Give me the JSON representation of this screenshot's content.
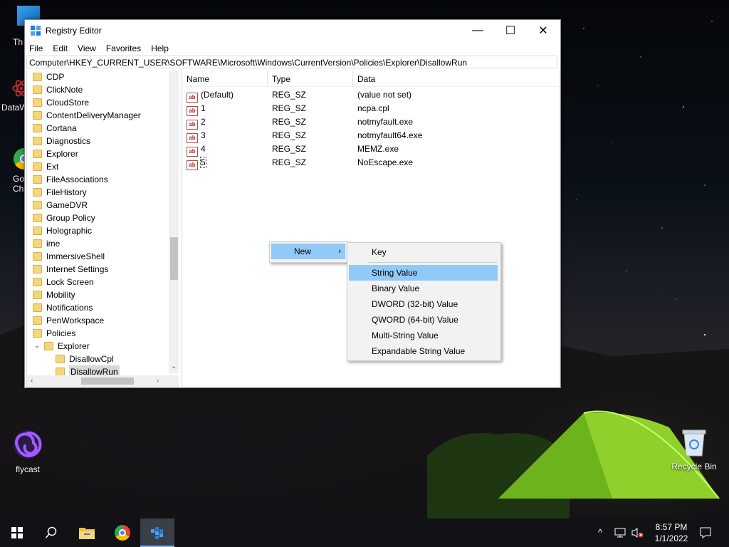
{
  "window": {
    "title": "Registry Editor",
    "controls": {
      "minimize": "—",
      "maximize": "☐",
      "close": "✕"
    },
    "menu": [
      "File",
      "Edit",
      "View",
      "Favorites",
      "Help"
    ],
    "address": "Computer\\HKEY_CURRENT_USER\\SOFTWARE\\Microsoft\\Windows\\CurrentVersion\\Policies\\Explorer\\DisallowRun"
  },
  "tree": {
    "items": [
      {
        "label": "CDP"
      },
      {
        "label": "ClickNote"
      },
      {
        "label": "CloudStore"
      },
      {
        "label": "ContentDeliveryManager"
      },
      {
        "label": "Cortana"
      },
      {
        "label": "Diagnostics"
      },
      {
        "label": "Explorer"
      },
      {
        "label": "Ext"
      },
      {
        "label": "FileAssociations"
      },
      {
        "label": "FileHistory"
      },
      {
        "label": "GameDVR"
      },
      {
        "label": "Group Policy"
      },
      {
        "label": "Holographic"
      },
      {
        "label": "ime"
      },
      {
        "label": "ImmersiveShell"
      },
      {
        "label": "Internet Settings"
      },
      {
        "label": "Lock Screen"
      },
      {
        "label": "Mobility"
      },
      {
        "label": "Notifications"
      },
      {
        "label": "PenWorkspace"
      },
      {
        "label": "Policies"
      },
      {
        "label": "Explorer"
      },
      {
        "label": "DisallowCpl"
      },
      {
        "label": "DisallowRun"
      }
    ]
  },
  "list": {
    "columns": [
      "Name",
      "Type",
      "Data"
    ],
    "rows": [
      {
        "name": "(Default)",
        "type": "REG_SZ",
        "data": "(value not set)"
      },
      {
        "name": "1",
        "type": "REG_SZ",
        "data": "ncpa.cpl"
      },
      {
        "name": "2",
        "type": "REG_SZ",
        "data": "notmyfault.exe"
      },
      {
        "name": "3",
        "type": "REG_SZ",
        "data": "notmyfault64.exe"
      },
      {
        "name": "4",
        "type": "REG_SZ",
        "data": "MEMZ.exe"
      },
      {
        "name": "5",
        "type": "REG_SZ",
        "data": "NoEscape.exe"
      }
    ],
    "value_icon": "ab"
  },
  "context_menu": {
    "new_label": "New",
    "submenu": [
      "Key",
      "String Value",
      "Binary Value",
      "DWORD (32-bit) Value",
      "QWORD (64-bit) Value",
      "Multi-String Value",
      "Expandable String Value"
    ],
    "highlighted": "String Value"
  },
  "desktop": {
    "icons": {
      "top_label": "Th",
      "datawrangler": "DataW",
      "chrome_line1": "Go",
      "chrome_line2": "Ch",
      "flycast": "flycast",
      "recycle": "Recycle Bin"
    }
  },
  "taskbar": {
    "time": "8:57 PM",
    "date": "1/1/2022"
  },
  "colors": {
    "highlight": "#91c9f7",
    "folder": "#f6d67a",
    "taskbar": "#101216"
  }
}
